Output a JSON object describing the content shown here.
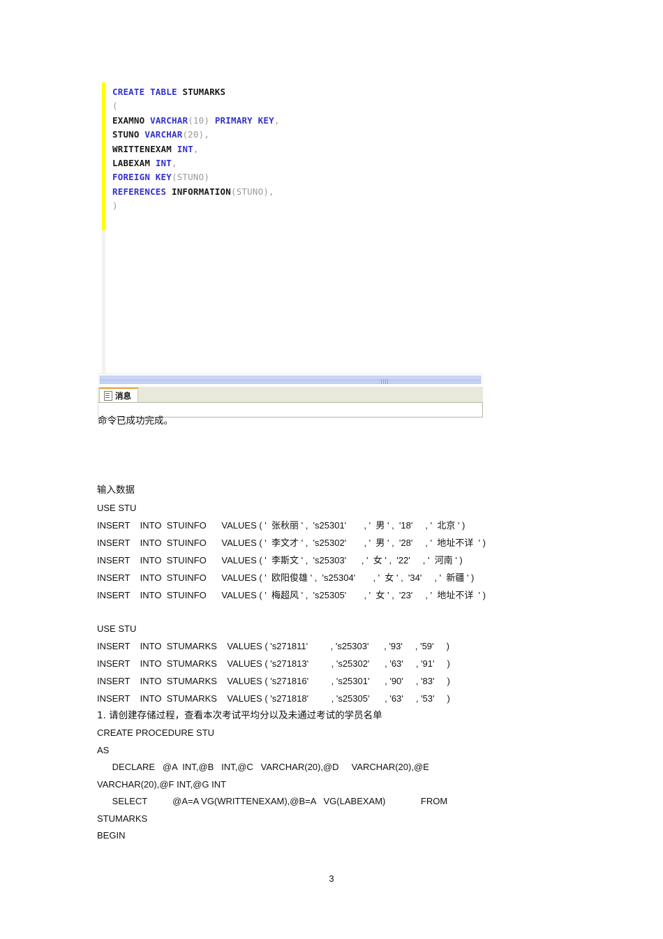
{
  "editor": {
    "code_lines": [
      [
        {
          "t": "CREATE TABLE ",
          "c": "kw"
        },
        {
          "t": "STUMARKS",
          "c": "idn"
        }
      ],
      [
        {
          "t": "(",
          "c": "pun"
        }
      ],
      [
        {
          "t": "EXAMNO ",
          "c": "idn"
        },
        {
          "t": "VARCHAR",
          "c": "kw"
        },
        {
          "t": "(10)",
          "c": "pun"
        },
        {
          "t": " ",
          "c": "idn"
        },
        {
          "t": "PRIMARY KEY",
          "c": "kw"
        },
        {
          "t": ",",
          "c": "pun"
        }
      ],
      [
        {
          "t": "STUNO ",
          "c": "idn"
        },
        {
          "t": "VARCHAR",
          "c": "kw"
        },
        {
          "t": "(20),",
          "c": "pun"
        }
      ],
      [
        {
          "t": "WRITTENEXAM ",
          "c": "idn"
        },
        {
          "t": "INT",
          "c": "kw"
        },
        {
          "t": ",",
          "c": "pun"
        }
      ],
      [
        {
          "t": "LABEXAM ",
          "c": "idn"
        },
        {
          "t": "INT",
          "c": "kw"
        },
        {
          "t": ",",
          "c": "pun"
        }
      ],
      [
        {
          "t": "FOREIGN KEY",
          "c": "kw"
        },
        {
          "t": "(STUNO)",
          "c": "pun"
        }
      ],
      [
        {
          "t": "REFERENCES ",
          "c": "kw"
        },
        {
          "t": "INFORMATION",
          "c": "idn"
        },
        {
          "t": "(STUNO),",
          "c": "pun"
        }
      ],
      [
        {
          "t": ")",
          "c": "pun"
        }
      ]
    ]
  },
  "results": {
    "tab_label": "消息",
    "message": "命令已成功完成。"
  },
  "document": {
    "section_heading": "输入数据",
    "use_stu_1": "USE STU",
    "stuinfo_inserts": [
      "INSERT    INTO  STUINFO      VALUES ( '  张秋丽 ' ,  's25301'       , '  男 ' ,  '18'     , '  北京 ' )",
      "INSERT    INTO  STUINFO      VALUES ( '  李文才 ' ,  's25302'       , '  男 ' ,  '28'     , '  地址不详  ' )",
      "INSERT    INTO  STUINFO      VALUES ( '  李斯文 ' ,  's25303'      , '  女 ' ,  '22'     , '  河南 ' )",
      "INSERT    INTO  STUINFO      VALUES ( '  欧阳俊雄 ' ,  's25304'       , '  女 ' ,  '34'     , '  新疆 ' )",
      "INSERT    INTO  STUINFO      VALUES ( '  梅超风 ' ,  's25305'       , '  女 ' ,  '23'     , '  地址不详  ' )"
    ],
    "use_stu_2": "USE STU",
    "stumarks_inserts": [
      "INSERT    INTO  STUMARKS    VALUES ( 's271811'         , 's25303'      , '93'     , '59'     )",
      "INSERT    INTO  STUMARKS    VALUES ( 's271813'         , 's25302'      , '63'     , '91'     )",
      "INSERT    INTO  STUMARKS    VALUES ( 's271816'         , 's25301'      , '90'     , '83'     )",
      "INSERT    INTO  STUMARKS    VALUES ( 's271818'         , 's25305'      , '63'     , '53'     )"
    ],
    "question_1": "1. 请创建存储过程，查看本次考试平均分以及未通过考试的学员名单",
    "procedure_lines": [
      "CREATE PROCEDURE STU",
      "AS",
      "      DECLARE   @A  INT,@B   INT,@C   VARCHAR(20),@D     VARCHAR(20),@E",
      "VARCHAR(20),@F INT,@G INT",
      "      SELECT          @A=A VG(WRITTENEXAM),@B=A   VG(LABEXAM)              FROM",
      "STUMARKS",
      "BEGIN"
    ]
  },
  "footer": {
    "page_number": "3"
  },
  "colors": {
    "keyword": "#3333cc",
    "change_bar": "#ffff00",
    "tab_accent": "#e8a33d",
    "tabstrip_bg": "#e9e9da",
    "scroll_thumb": "#c2cff3"
  }
}
